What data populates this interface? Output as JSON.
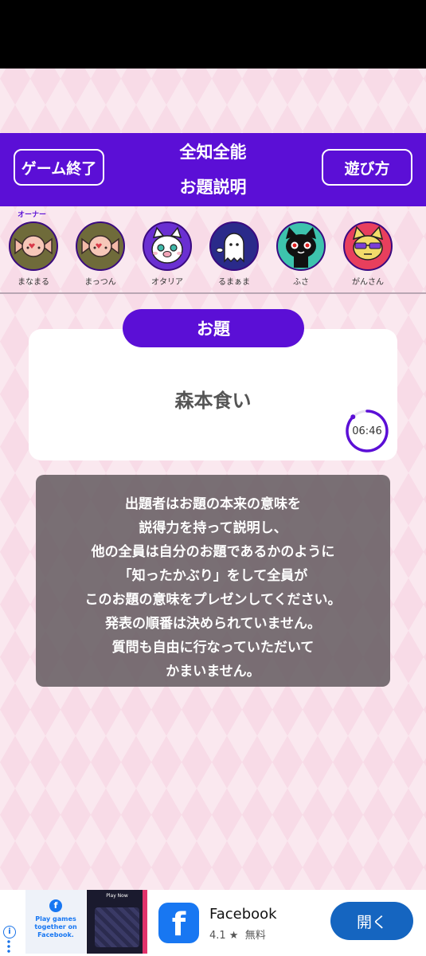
{
  "header": {
    "end_game_label": "ゲーム終了",
    "title_line1": "全知全能",
    "title_line2": "お題説明",
    "how_to_play_label": "遊び方"
  },
  "owner_label": "オーナー",
  "players": [
    {
      "name": "まなまる",
      "avatar": "candy-icon"
    },
    {
      "name": "まっつん",
      "avatar": "candy-icon"
    },
    {
      "name": "オタリア",
      "avatar": "white-cat-pig-nose-icon"
    },
    {
      "name": "るまぁま",
      "avatar": "ghost-icon"
    },
    {
      "name": "ふさ",
      "avatar": "black-cat-icon"
    },
    {
      "name": "がんさん",
      "avatar": "yellow-cat-sunglasses-icon"
    }
  ],
  "topic": {
    "label": "お題",
    "word": "森本食い",
    "timer": "06:46"
  },
  "description": [
    "出題者はお題の本来の意味を",
    "説得力を持って説明し、",
    "他の全員は自分のお題であるかのように",
    "「知ったかぶり」をして全員が",
    "このお題の意味をプレゼンしてください。",
    "発表の順番は決められていません。",
    "質問も自由に行なっていただいて",
    "かまいません。"
  ],
  "ad": {
    "thumb_text": "Play games together on Facebook.",
    "thumb2_text": "Play Now",
    "app_name": "Facebook",
    "rating": "4.1 ★",
    "price": "無料",
    "open_label": "開く"
  },
  "colors": {
    "accent": "#5b0fd6",
    "background": "#f8dbe7",
    "ad_button": "#1565c0"
  }
}
